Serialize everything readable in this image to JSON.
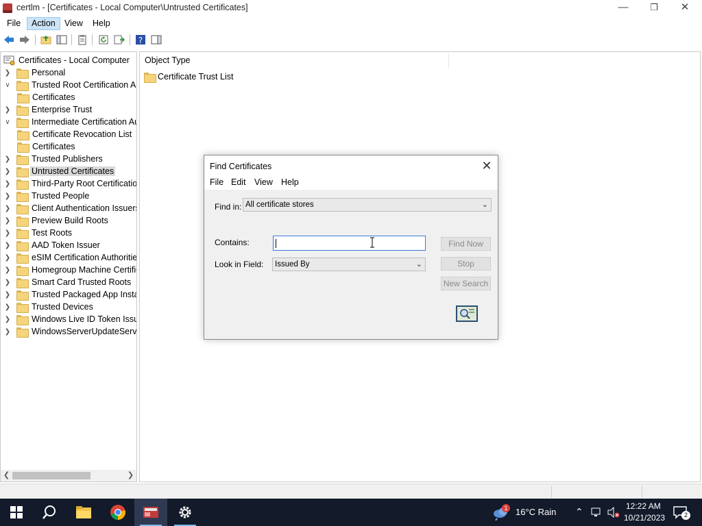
{
  "window": {
    "title": "certlm - [Certificates - Local Computer\\Untrusted Certificates]",
    "minimize_glyph": "—",
    "maximize_glyph": "❐",
    "close_glyph": "✕"
  },
  "menubar": {
    "items": [
      "File",
      "Action",
      "View",
      "Help"
    ],
    "active": "Action"
  },
  "toolbar": {
    "icons": [
      "back-arrow-icon",
      "forward-arrow-icon",
      "up-folder-icon",
      "show-hide-tree-icon",
      "properties-icon",
      "refresh-icon",
      "export-list-icon",
      "help-icon",
      "action-pane-icon"
    ]
  },
  "tree": {
    "root": "Certificates - Local Computer",
    "items": [
      {
        "label": "Personal",
        "level": 1,
        "expander": ">"
      },
      {
        "label": "Trusted Root Certification Au",
        "level": 1,
        "expander": "v"
      },
      {
        "label": "Certificates",
        "level": 2,
        "expander": ""
      },
      {
        "label": "Enterprise Trust",
        "level": 1,
        "expander": ">"
      },
      {
        "label": "Intermediate Certification Au",
        "level": 1,
        "expander": "v"
      },
      {
        "label": "Certificate Revocation List",
        "level": 2,
        "expander": ""
      },
      {
        "label": "Certificates",
        "level": 2,
        "expander": ""
      },
      {
        "label": "Trusted Publishers",
        "level": 1,
        "expander": ">"
      },
      {
        "label": "Untrusted Certificates",
        "level": 1,
        "expander": ">",
        "selected": true
      },
      {
        "label": "Third-Party Root Certification",
        "level": 1,
        "expander": ">"
      },
      {
        "label": "Trusted People",
        "level": 1,
        "expander": ">"
      },
      {
        "label": "Client Authentication Issuers",
        "level": 1,
        "expander": ">"
      },
      {
        "label": "Preview Build Roots",
        "level": 1,
        "expander": ">"
      },
      {
        "label": "Test Roots",
        "level": 1,
        "expander": ">"
      },
      {
        "label": "AAD Token Issuer",
        "level": 1,
        "expander": ">"
      },
      {
        "label": "eSIM Certification Authorities",
        "level": 1,
        "expander": ">"
      },
      {
        "label": "Homegroup Machine Certific",
        "level": 1,
        "expander": ">"
      },
      {
        "label": "Smart Card Trusted Roots",
        "level": 1,
        "expander": ">"
      },
      {
        "label": "Trusted Packaged App Installa",
        "level": 1,
        "expander": ">"
      },
      {
        "label": "Trusted Devices",
        "level": 1,
        "expander": ">"
      },
      {
        "label": "Windows Live ID Token Issuer",
        "level": 1,
        "expander": ">"
      },
      {
        "label": "WindowsServerUpdateService",
        "level": 1,
        "expander": ">"
      }
    ]
  },
  "list": {
    "column_header": "Object Type",
    "rows": [
      "Certificate Trust List"
    ]
  },
  "dialog": {
    "title": "Find Certificates",
    "close_glyph": "✕",
    "menu": [
      "File",
      "Edit",
      "View",
      "Help"
    ],
    "find_in_label": "Find in:",
    "find_in_value": "All certificate stores",
    "contains_label": "Contains:",
    "contains_value": "",
    "look_in_label": "Look in Field:",
    "look_in_value": "Issued By",
    "buttons": {
      "find_now": "Find Now",
      "stop": "Stop",
      "new_search": "New Search"
    }
  },
  "taskbar": {
    "apps": [
      "windows-start-icon",
      "search-icon",
      "file-explorer-icon",
      "chrome-icon",
      "certlm-icon",
      "settings-icon"
    ],
    "weather": "16°C  Rain",
    "weather_badge": "1",
    "time": "12:22 AM",
    "date": "10/21/2023",
    "notifications": "2"
  }
}
